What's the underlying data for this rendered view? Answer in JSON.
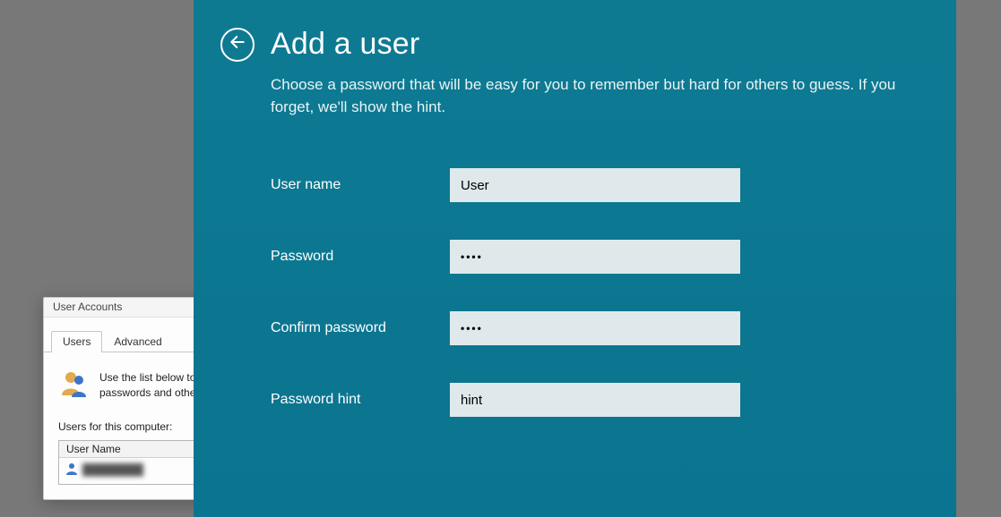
{
  "background": {
    "title": "User Accounts",
    "tab_users": "Users",
    "tab_advanced": "Advanced",
    "description": "Use the list below to grant or deny users access to your computer, and to change passwords and other settings.",
    "sublabel": "Users for this computer:",
    "list_header": "User Name"
  },
  "modal": {
    "title": "Add a user",
    "instruction": "Choose a password that will be easy for you to remember but hard for others to guess. If you forget, we'll show the hint."
  },
  "field_labels": {
    "username": "User name",
    "password": "Password",
    "confirm": "Confirm password",
    "hint": "Password hint"
  },
  "values": {
    "username": "User",
    "password": "••••",
    "confirm": "••••",
    "hint": "hint"
  },
  "colors": {
    "panel": "#0e7490",
    "input_bg": "#dfe9eb"
  }
}
